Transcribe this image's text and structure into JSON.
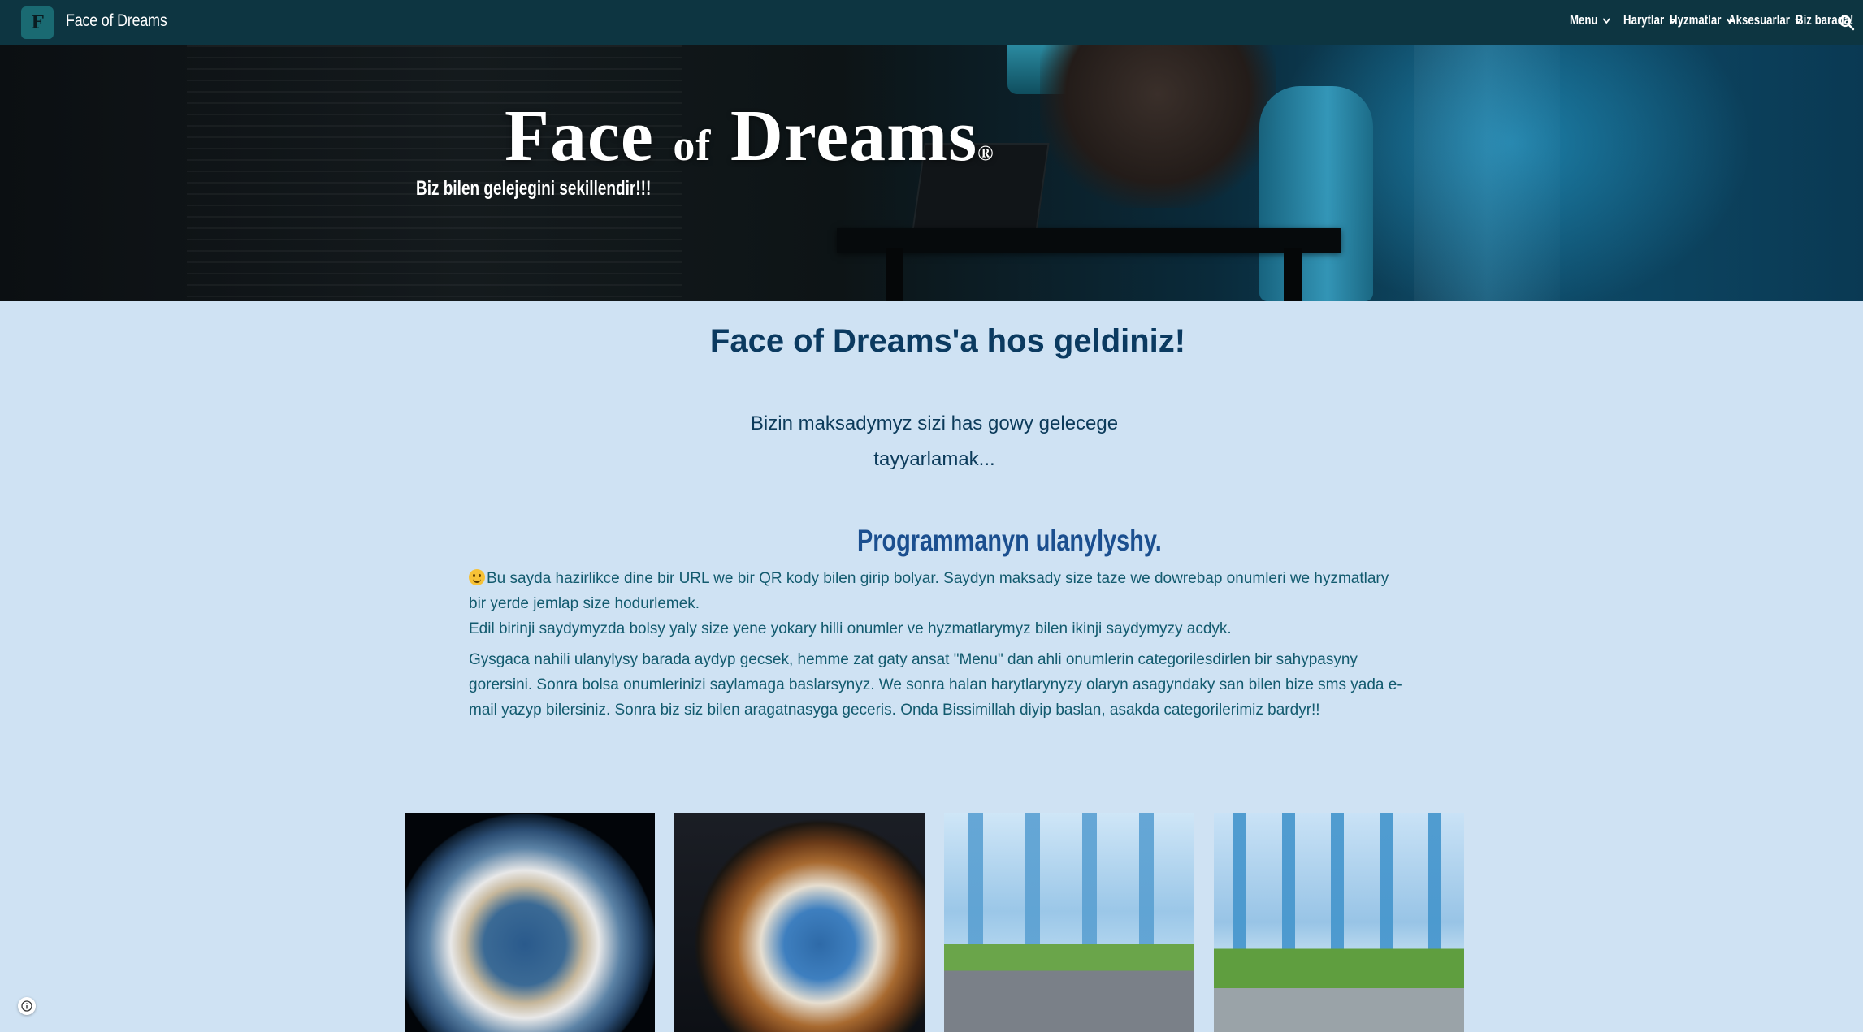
{
  "header": {
    "logo_text": "F",
    "site_title": "Face of Dreams",
    "nav": [
      {
        "label": "Menu",
        "has_dropdown": true
      },
      {
        "label": "Harytlar",
        "has_dropdown": true
      },
      {
        "label": "Hyzmatlar",
        "has_dropdown": true
      },
      {
        "label": "Aksesuarlar",
        "has_dropdown": true
      },
      {
        "label": "Biz barada!",
        "has_dropdown": false
      }
    ],
    "search_icon": "search-icon"
  },
  "hero": {
    "title_main": "Face",
    "title_of": "of",
    "title_end": "Dreams",
    "title_mark": "®",
    "subtitle": "Biz bilen gelejegini sekillendir!!!"
  },
  "main": {
    "welcome": "Face of Dreams'a hos geldiniz!",
    "intro_line1": "Bizin maksadymyz sizi has gowy gelecege",
    "intro_line2": "tayyarlamak...",
    "section_title": "Programmanyn ulanylyshy.",
    "paragraph1": "Bu sayda hazirlikce dine bir URL we bir QR kody bilen girip bolyar. Saydyn maksady size taze we dowrebap onumleri we hyzmatlary bir yerde jemlap size hodurlemek.",
    "paragraph2": "Edil birinji saydymyzda bolsy yaly size yene yokary hilli onumler ve hyzmatlarymyz bilen ikinji saydymyzy acdyk.",
    "paragraph3": "Gysgaca nahili ulanylysy barada aydyp gecsek, hemme zat gaty ansat \"Menu\" dan ahli onumlerin categorilesdirlen bir sahypasyny gorersini. Sonra bolsa onumlerinizi saylamaga baslarsynyz. We sonra halan harytlarynyzy olaryn asagyndaky san bilen bize sms yada e-mail yazyp bilersiniz. Sonra biz siz bilen aragatnasyga geceris. Onda Bissimillah diyip baslan, asakda categorilerimiz bardyr!!"
  },
  "colors": {
    "nav_bg": "#0d3541",
    "page_bg": "#cfe2f3",
    "heading": "#0b3a60",
    "section_heading": "#1b4f8f",
    "body_text": "#125a6e"
  }
}
